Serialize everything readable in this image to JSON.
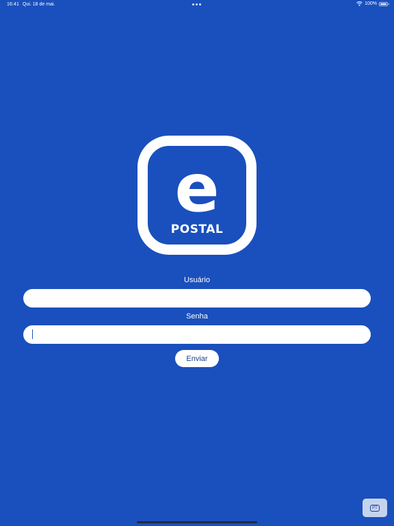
{
  "status_bar": {
    "time": "16:41",
    "date": "Qui. 18 de mai.",
    "battery": "100%"
  },
  "logo": {
    "letter": "e",
    "word": "POSTAL"
  },
  "form": {
    "username_label": "Usuário",
    "username_value": "",
    "password_label": "Senha",
    "password_value": "",
    "submit_label": "Enviar"
  },
  "language": {
    "label": "PT"
  },
  "colors": {
    "background": "#1a50bd",
    "field": "#ffffff",
    "button_text": "#1a3f8f",
    "language_button": "#c5d3ee"
  }
}
